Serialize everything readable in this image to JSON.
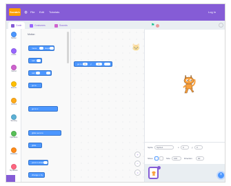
{
  "menubar": {
    "logo": "Scratch",
    "items": [
      {
        "name": "globe-icon",
        "glyph": "◍"
      },
      {
        "name": "file-menu",
        "label": "File"
      },
      {
        "name": "edit-menu",
        "label": "Edit"
      },
      {
        "name": "tutorials-menu",
        "label": "Tutorials"
      }
    ],
    "user": "Log In"
  },
  "tabs": [
    {
      "label": "Code",
      "icon": "code-icon",
      "color": "#855cd6"
    },
    {
      "label": "Costumes",
      "icon": "costumes-icon",
      "color": "#9966ff"
    },
    {
      "label": "Sounds",
      "icon": "sounds-icon",
      "color": "#cf63cf"
    }
  ],
  "categories": [
    {
      "label": "Motion",
      "color": "#4c97ff"
    },
    {
      "label": "Looks",
      "color": "#9966ff"
    },
    {
      "label": "Sound",
      "color": "#cf63cf"
    },
    {
      "label": "Events",
      "color": "#ffbf00"
    },
    {
      "label": "Control",
      "color": "#ffab19"
    },
    {
      "label": "Sensing",
      "color": "#5cb1d6"
    },
    {
      "label": "Operators",
      "color": "#59c059"
    },
    {
      "label": "Variables",
      "color": "#ff8c1a"
    },
    {
      "label": "My Blocks",
      "color": "#ff6680"
    }
  ],
  "palette": {
    "heading": "Motion",
    "blocks": [
      {
        "label": "move",
        "value": "10",
        "suffix": "steps"
      },
      {
        "label": "turn",
        "value": "15"
      },
      {
        "label": "turn",
        "value": "15",
        "suffix": "degrees"
      },
      {
        "label": "go to",
        "value": "random position"
      },
      {
        "label": "go to x:",
        "value": "0"
      },
      {
        "label": "glide secs to",
        "value": "random position"
      },
      {
        "label": "glide",
        "value": "1",
        "suffix": "secs to x:"
      },
      {
        "label": "point in direction",
        "value": "90"
      },
      {
        "label": "change x by",
        "value": "10"
      }
    ]
  },
  "script": {
    "block": "go to x:",
    "x_value": "0",
    "y_label": "y:",
    "y_value": "0"
  },
  "zoom": {
    "zoom_in": "+",
    "zoom_out": "−",
    "reset": "="
  },
  "stage_header": {
    "flag": "⚑"
  },
  "sprite_info": {
    "sprite_label": "Sprite",
    "sprite_name": "Sprite1",
    "x_label": "x",
    "x_value": "0",
    "y_label": "y",
    "y_value": "0",
    "show_label": "Show",
    "size_label": "Size",
    "size_value": "100",
    "direction_label": "Direction",
    "direction_value": "90"
  },
  "colors": {
    "accent": "#855cd6",
    "motion_block": "#4c97ff",
    "cat_orange": "#ff9f00"
  }
}
